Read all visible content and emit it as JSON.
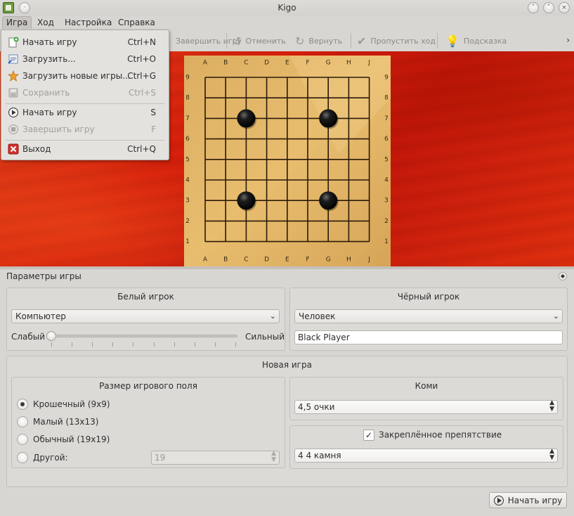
{
  "window": {
    "title": "Kigo"
  },
  "menubar": {
    "items": [
      "Игра",
      "Ход",
      "Настройка",
      "Справка"
    ]
  },
  "toolbar": {
    "end_game": "Завершить игру",
    "undo": "Отменить",
    "redo": "Вернуть",
    "pass": "Пропустить ход",
    "hint": "Подсказка",
    "more": "›"
  },
  "game_menu": {
    "items": [
      {
        "label": "Начать игру",
        "shortcut": "Ctrl+N",
        "icon": "new-document-icon",
        "enabled": true
      },
      {
        "label": "Загрузить...",
        "shortcut": "Ctrl+O",
        "icon": "open-document-icon",
        "enabled": true
      },
      {
        "label": "Загрузить новые игры...",
        "shortcut": "Ctrl+G",
        "icon": "star-icon",
        "enabled": true
      },
      {
        "label": "Сохранить",
        "shortcut": "Ctrl+S",
        "icon": "save-icon",
        "enabled": false
      },
      {
        "label": "Начать игру",
        "shortcut": "S",
        "icon": "play-icon",
        "enabled": true
      },
      {
        "label": "Завершить игру",
        "shortcut": "F",
        "icon": "stop-icon",
        "enabled": false
      },
      {
        "label": "Выход",
        "shortcut": "Ctrl+Q",
        "icon": "quit-icon",
        "enabled": true
      }
    ]
  },
  "board": {
    "size": 9,
    "columns": [
      "A",
      "B",
      "C",
      "D",
      "E",
      "F",
      "G",
      "H",
      "J"
    ],
    "rows": [
      "9",
      "8",
      "7",
      "6",
      "5",
      "4",
      "3",
      "2",
      "1"
    ],
    "stones": [
      {
        "color": "black",
        "point": "C7"
      },
      {
        "color": "black",
        "point": "G7"
      },
      {
        "color": "black",
        "point": "C3"
      },
      {
        "color": "black",
        "point": "G3"
      }
    ]
  },
  "dock": {
    "title": "Параметры игры",
    "white": {
      "title": "Белый игрок",
      "type": "Компьютер",
      "weak": "Слабый",
      "strong": "Сильный",
      "strength_fraction": 0.0
    },
    "black": {
      "title": "Чёрный игрок",
      "type": "Человек",
      "name": "Black Player"
    },
    "new_game": {
      "title": "Новая игра",
      "board_size_title": "Размер игрового поля",
      "sizes": [
        {
          "label": "Крошечный (9x9)",
          "checked": true
        },
        {
          "label": "Малый (13x13)",
          "checked": false
        },
        {
          "label": "Обычный (19x19)",
          "checked": false
        },
        {
          "label": "Другой:",
          "checked": false
        }
      ],
      "other_value": "19",
      "komi_title": "Коми",
      "komi_value": "4,5 очки",
      "fixed_handicap_label": "Закреплённое препятствие",
      "fixed_handicap_checked": true,
      "handicap_value": "4 4 камня",
      "start_button": "Начать игру"
    }
  }
}
